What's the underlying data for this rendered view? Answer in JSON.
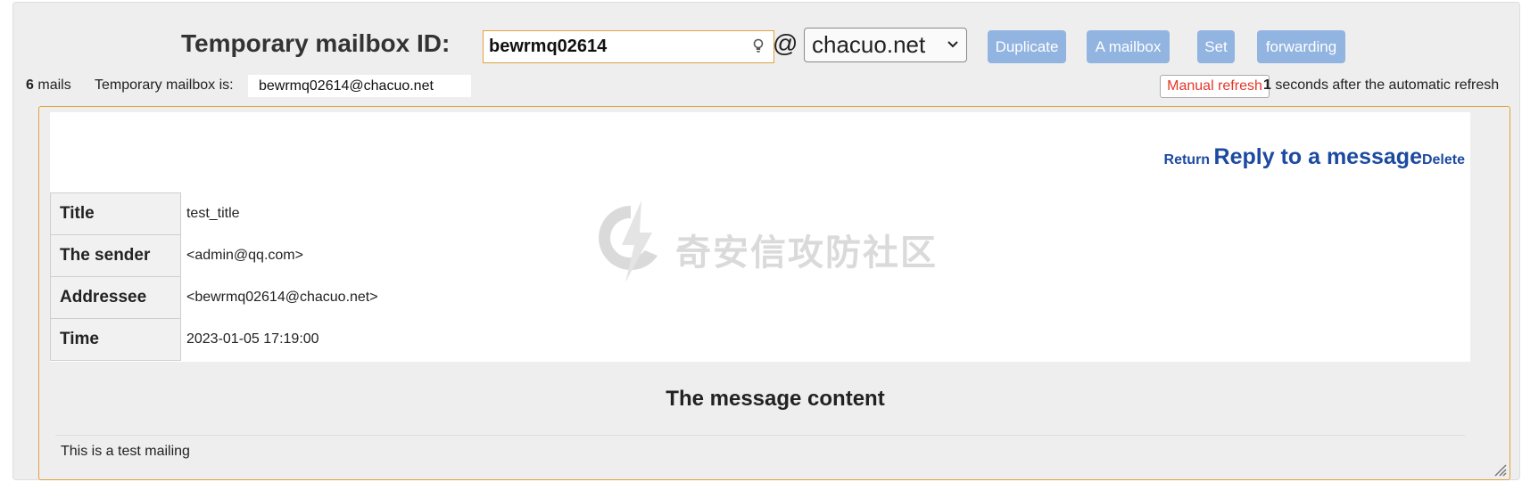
{
  "header": {
    "title": "Temporary mailbox ID:",
    "mailbox_id": "bewrmq02614",
    "at": "@",
    "domain": "chacuo.net",
    "buttons": {
      "duplicate": "Duplicate",
      "a_mailbox": "A mailbox",
      "set": "Set",
      "forwarding": "forwarding"
    }
  },
  "info": {
    "count": "6",
    "count_suffix": "mails",
    "address_label": "Temporary mailbox is:",
    "address": "bewrmq02614@chacuo.net",
    "manual_refresh": "Manual refresh",
    "auto_count": "1",
    "auto_text": "seconds after the automatic refresh"
  },
  "mail": {
    "actions": {
      "return": "Return",
      "reply": "Reply to a message",
      "delete": "Delete"
    },
    "fields": [
      {
        "label": "Title",
        "value": "test_title"
      },
      {
        "label": "The sender",
        "value": "<admin@qq.com>"
      },
      {
        "label": "Addressee",
        "value": "<bewrmq02614@chacuo.net>"
      },
      {
        "label": "Time",
        "value": "2023-01-05 17:19:00"
      }
    ],
    "content_heading": "The message content",
    "content_body": "This is a test mailing"
  },
  "watermark": {
    "text": "奇安信攻防社区"
  },
  "colors": {
    "button_bg": "#92b4e0",
    "accent_border": "#e1a23b",
    "link_blue": "#1c4aa0",
    "refresh_red": "#e2372a"
  },
  "icons": {
    "hint": "lightbulb-icon",
    "dropdown": "chevron-down-icon",
    "resize": "resize-handle-icon"
  }
}
